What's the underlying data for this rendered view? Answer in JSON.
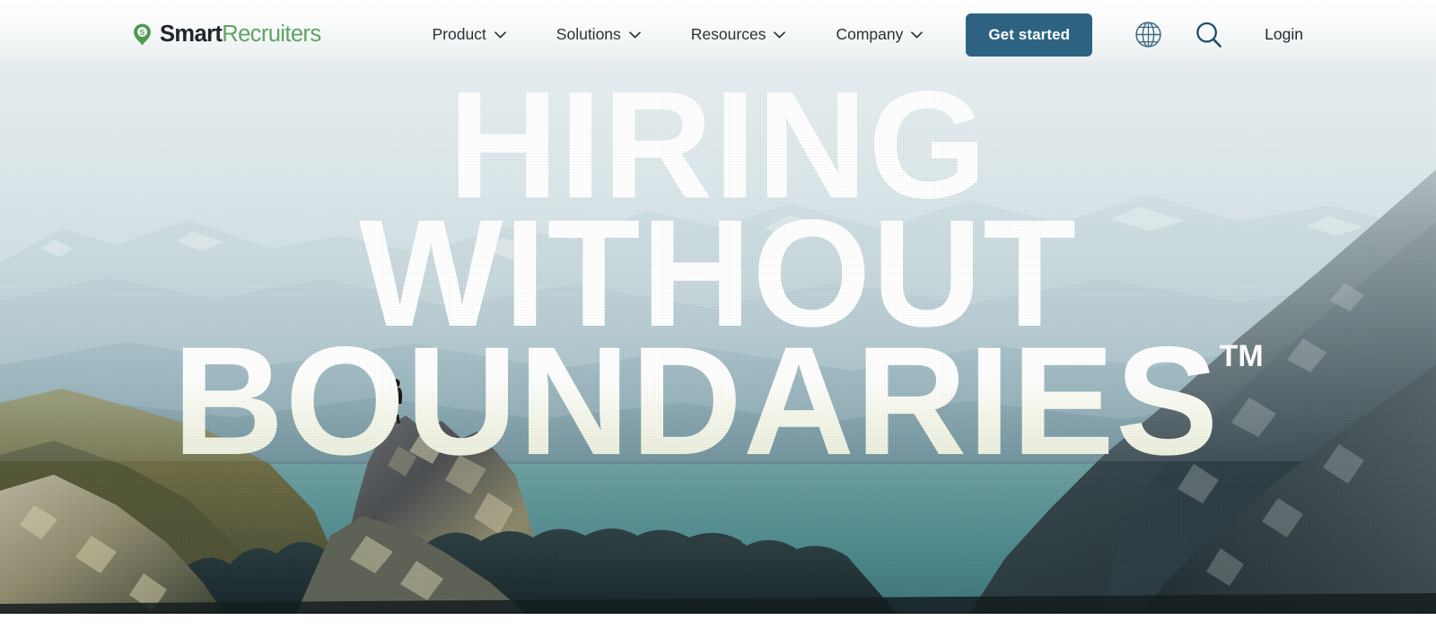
{
  "header": {
    "brand": {
      "icon": "location-pin-s-icon",
      "text_primary": "Smart",
      "text_secondary": "Recruiters"
    },
    "nav": [
      {
        "label": "Product",
        "icon": "chevron-down-icon"
      },
      {
        "label": "Solutions",
        "icon": "chevron-down-icon"
      },
      {
        "label": "Resources",
        "icon": "chevron-down-icon"
      },
      {
        "label": "Company",
        "icon": "chevron-down-icon"
      }
    ],
    "cta_label": "Get started",
    "language_icon": "globe-icon",
    "search_icon": "search-icon",
    "login_label": "Login"
  },
  "hero": {
    "headline_line1": "HIRING",
    "headline_line2": "WITHOUT",
    "headline_line3": "BOUNDARIES",
    "trademark": "TM",
    "image_description": "hiker standing on a rocky outcrop overlooking misty layered mountains and a teal alpine valley"
  },
  "colors": {
    "cta_background": "#2d6381",
    "brand_green": "#5fa463",
    "brand_dark": "#20262b",
    "nav_text": "#2b3238",
    "headline": "#ffffff",
    "header_gradient_top": "#ffffff",
    "header_gradient_bottom": "#e4ebec",
    "valley_teal": "#4e8a8e"
  }
}
